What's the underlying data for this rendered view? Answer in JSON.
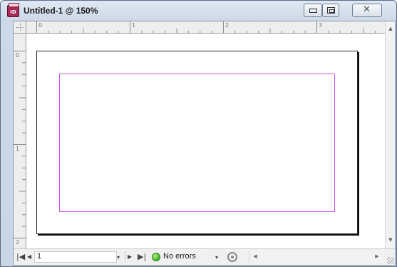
{
  "window": {
    "title": "Untitled-1 @ 150%",
    "app_icon_text": "ID",
    "buttons": {
      "minimize": "minimize",
      "maximize": "maximize",
      "close": "close"
    }
  },
  "rulers": {
    "horizontal_labels": [
      "0",
      "1",
      "2",
      "3"
    ],
    "vertical_labels": [
      "0",
      "1",
      "2"
    ]
  },
  "document": {
    "page_border_color": "#222222",
    "margin_guide_color": "#d04ff0"
  },
  "statusbar": {
    "first_page_icon": "first-page-icon",
    "prev_page_icon": "previous-page-icon",
    "page_value": "1",
    "page_dropdown_icon": "chevron-down-icon",
    "next_page_icon": "next-page-icon",
    "last_page_icon": "last-page-icon",
    "preflight_status": "No errors",
    "preflight_menu_icon": "chevron-down-icon",
    "preflight_panel_icon": "preflight-icon"
  },
  "scrollbars": {
    "up_arrow": "▲",
    "down_arrow": "▼",
    "left_arrow": "◀",
    "right_arrow": "▶"
  }
}
